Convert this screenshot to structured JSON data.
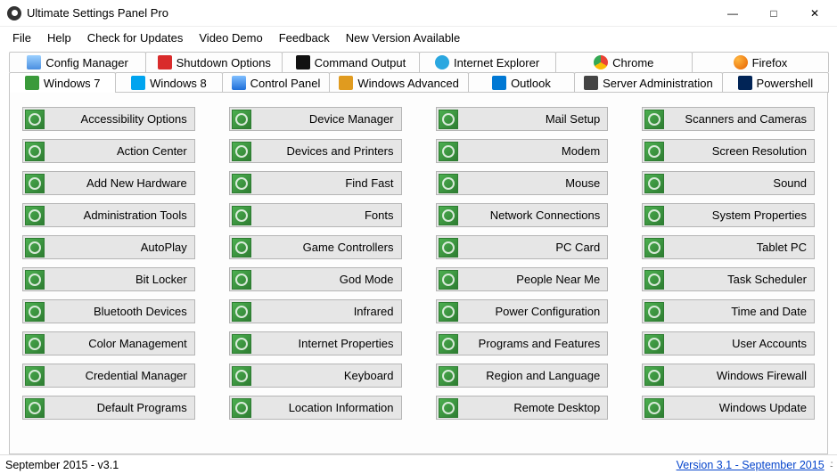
{
  "window": {
    "title": "Ultimate Settings Panel Pro"
  },
  "menu": {
    "file": "File",
    "help": "Help",
    "updates": "Check for Updates",
    "video": "Video Demo",
    "feedback": "Feedback",
    "newversion": "New Version Available"
  },
  "tabs_row1": {
    "config": "Config Manager",
    "shutdown": "Shutdown Options",
    "command": "Command Output",
    "ie": "Internet Explorer",
    "chrome": "Chrome",
    "firefox": "Firefox"
  },
  "tabs_row2": {
    "win7": "Windows 7",
    "win8": "Windows 8",
    "cpanel": "Control Panel",
    "winadv": "Windows Advanced",
    "outlook": "Outlook",
    "serveradmin": "Server Administration",
    "powershell": "Powershell"
  },
  "buttons": {
    "col1": {
      "b0": "Accessibility Options",
      "b1": "Action Center",
      "b2": "Add New Hardware",
      "b3": "Administration Tools",
      "b4": "AutoPlay",
      "b5": "Bit Locker",
      "b6": "Bluetooth Devices",
      "b7": "Color Management",
      "b8": "Credential Manager",
      "b9": "Default Programs"
    },
    "col2": {
      "b0": "Device Manager",
      "b1": "Devices and Printers",
      "b2": "Find Fast",
      "b3": "Fonts",
      "b4": "Game Controllers",
      "b5": "God Mode",
      "b6": "Infrared",
      "b7": "Internet Properties",
      "b8": "Keyboard",
      "b9": "Location Information"
    },
    "col3": {
      "b0": "Mail Setup",
      "b1": "Modem",
      "b2": "Mouse",
      "b3": "Network Connections",
      "b4": "PC Card",
      "b5": "People Near Me",
      "b6": "Power Configuration",
      "b7": "Programs and Features",
      "b8": "Region and Language",
      "b9": "Remote Desktop"
    },
    "col4": {
      "b0": "Scanners and Cameras",
      "b1": "Screen Resolution",
      "b2": "Sound",
      "b3": "System Properties",
      "b4": "Tablet PC",
      "b5": "Task Scheduler",
      "b6": "Time and Date",
      "b7": "User Accounts",
      "b8": "Windows Firewall",
      "b9": "Windows Update"
    }
  },
  "status": {
    "left": "September 2015 - v3.1",
    "right": "Version 3.1 - September 2015"
  },
  "colors": {
    "icon_green": "#3a9a3a"
  }
}
